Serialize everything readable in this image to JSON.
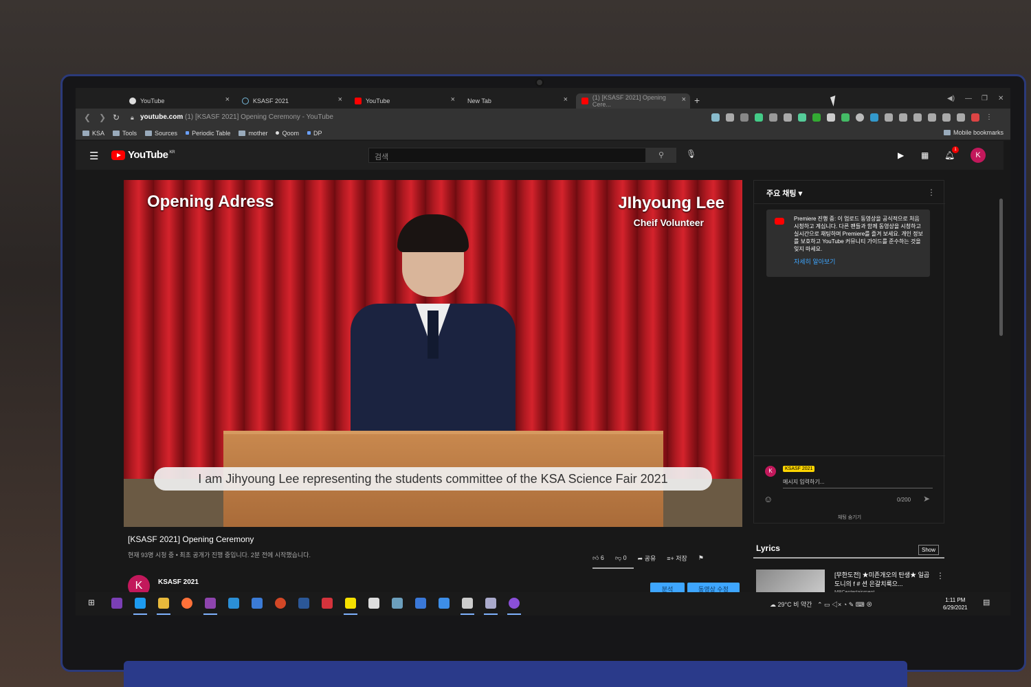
{
  "tabs": [
    {
      "label": "YouTube",
      "icon": "google-icon"
    },
    {
      "label": "KSASF 2021",
      "icon": "globe-icon"
    },
    {
      "label": "YouTube",
      "icon": "youtube-icon"
    },
    {
      "label": "New Tab",
      "icon": ""
    },
    {
      "label": "(1) [KSASF 2021] Opening Cere...",
      "icon": "youtube-icon",
      "active": true
    }
  ],
  "address": {
    "domain": "youtube.com",
    "rest": "(1) [KSASF 2021] Opening Ceremony - YouTube"
  },
  "bookmarks": [
    {
      "label": "KSA",
      "type": "folder"
    },
    {
      "label": "Tools",
      "type": "folder"
    },
    {
      "label": "Sources",
      "type": "folder"
    },
    {
      "label": "Periodic Table",
      "type": "link"
    },
    {
      "label": "mother",
      "type": "folder"
    },
    {
      "label": "Qoom",
      "type": "link"
    },
    {
      "label": "DP",
      "type": "link"
    }
  ],
  "mobile_bookmarks": "Mobile bookmarks",
  "header": {
    "logo": "YouTube",
    "region": "KR",
    "search_placeholder": "검색",
    "notif_count": "1",
    "avatar": "K"
  },
  "video": {
    "overlay_title": "Opening Adress",
    "overlay_name": "JIhyoung Lee",
    "overlay_role": "Cheif Volunteer",
    "caption": "I am Jihyoung Lee representing the students committee of the KSA Science Fair 2021",
    "title": "[KSASF 2021] Opening Ceremony",
    "meta": "현재 93명 시청 중 • 최초 공개가 진행 중입니다. 2분 전에 시작했습니다.",
    "likes": "6",
    "dislikes": "0",
    "share": "공유",
    "save": "저장"
  },
  "channel": {
    "avatar": "K",
    "name": "KSASF 2021",
    "analytics_button": "분석",
    "edit_button": "동영상 수정"
  },
  "chat": {
    "header": "주요 채팅",
    "notice": "Premiere 진행 중: 이 업로드 동영상을 공식적으로 처음 시청하고 계십니다. 다른 팬들과 함께 동영상을 시청하고 실시간으로 채팅하며 Premiere를 즐겨 보세요. 개인 정보를 보호하고 YouTube 커뮤니티 가이드를 준수하는 것을 잊지 마세요.",
    "learn_more": "자세히 알아보기",
    "user_chip": "KSASF 2021",
    "user_avatar": "K",
    "input_placeholder": "메시지 입력하기...",
    "char_count": "0/200",
    "hide_chat": "채팅 숨기기"
  },
  "lyrics": {
    "label": "Lyrics",
    "show": "Show"
  },
  "recommendation": {
    "title": "[무한도전] ★미존개오의 탄생★ 일곱 도니의 f # 션 은갈치룩으...",
    "channel": "MBCentertainment"
  },
  "taskbar": {
    "weather": "29°C 비 약간",
    "time": "1:11 PM",
    "date": "6/29/2021"
  }
}
